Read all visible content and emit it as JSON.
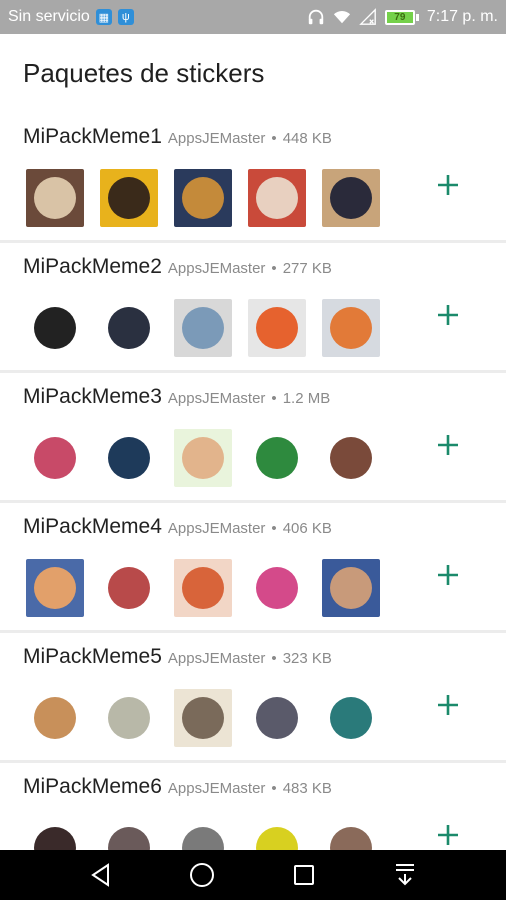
{
  "status_bar": {
    "carrier": "Sin servicio",
    "battery": "79",
    "time": "7:17 p. m.",
    "icons": [
      "sim-icon",
      "usb-icon",
      "headphones-icon",
      "wifi-icon",
      "no-signal-icon",
      "battery-icon"
    ]
  },
  "header": {
    "title": "Paquetes de stickers"
  },
  "packs": [
    {
      "name": "MiPackMeme1",
      "publisher": "AppsJEMaster",
      "size": "448 KB",
      "thumbs": [
        [
          "#6b4a3a",
          "#d9c3a6"
        ],
        [
          "#e8b21c",
          "#3a2a1a"
        ],
        [
          "#2a3a5c",
          "#c48a3a"
        ],
        [
          "#c94a3a",
          "#e8d0c0"
        ],
        [
          "#c8a47a",
          "#2a2a3a"
        ]
      ]
    },
    {
      "name": "MiPackMeme2",
      "publisher": "AppsJEMaster",
      "size": "277 KB",
      "thumbs": [
        [
          "#ffffff",
          "#222222"
        ],
        [
          "#ffffff",
          "#2a3040"
        ],
        [
          "#d8d8d8",
          "#7b9ab8"
        ],
        [
          "#e6e6e6",
          "#e6622e"
        ],
        [
          "#d6dae0",
          "#e27a38"
        ]
      ]
    },
    {
      "name": "MiPackMeme3",
      "publisher": "AppsJEMaster",
      "size": "1.2 MB",
      "thumbs": [
        [
          "#ffffff",
          "#c84a68"
        ],
        [
          "#ffffff",
          "#1e3a5a"
        ],
        [
          "#e9f4dc",
          "#e2b48c"
        ],
        [
          "#ffffff",
          "#2e8a3e"
        ],
        [
          "#ffffff",
          "#7a4a3a"
        ]
      ]
    },
    {
      "name": "MiPackMeme4",
      "publisher": "AppsJEMaster",
      "size": "406 KB",
      "thumbs": [
        [
          "#4a6aa8",
          "#e2a06a"
        ],
        [
          "#ffffff",
          "#b84a4a"
        ],
        [
          "#f2d6c6",
          "#d8643a"
        ],
        [
          "#ffffff",
          "#d44a8a"
        ],
        [
          "#3a5a9a",
          "#c89a7a"
        ]
      ]
    },
    {
      "name": "MiPackMeme5",
      "publisher": "AppsJEMaster",
      "size": "323 KB",
      "thumbs": [
        [
          "#ffffff",
          "#c8905a"
        ],
        [
          "#ffffff",
          "#b8b8a8"
        ],
        [
          "#ece4d4",
          "#7a6a5a"
        ],
        [
          "#ffffff",
          "#5a5a6a"
        ],
        [
          "#ffffff",
          "#2a7a7a"
        ]
      ]
    },
    {
      "name": "MiPackMeme6",
      "publisher": "AppsJEMaster",
      "size": "483 KB",
      "thumbs": [
        [
          "#ffffff",
          "#3a2a2a"
        ],
        [
          "#ffffff",
          "#6a5a5a"
        ],
        [
          "#ffffff",
          "#7a7a7a"
        ],
        [
          "#ffffff",
          "#d8d020"
        ],
        [
          "#ffffff",
          "#8a6a5a"
        ]
      ]
    }
  ],
  "colors": {
    "accent": "#1b8a6b",
    "status_bar": "#a8a8a8",
    "nav_bar": "#000000"
  },
  "nav": [
    "back-icon",
    "home-icon",
    "recents-icon",
    "notifications-icon"
  ]
}
